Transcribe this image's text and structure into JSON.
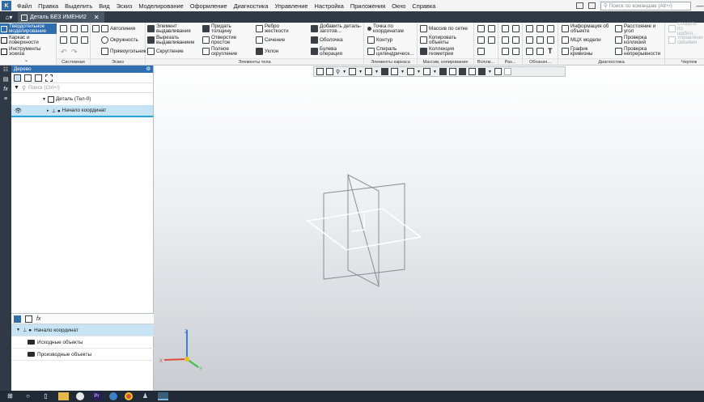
{
  "menu": {
    "logo_icon": "kompas-logo-icon",
    "items": [
      "Файл",
      "Правка",
      "Выделить",
      "Вид",
      "Эскиз",
      "Моделирование",
      "Оформление",
      "Диагностика",
      "Управление",
      "Настройка",
      "Приложения",
      "Окно",
      "Справка"
    ],
    "search_placeholder": "Поиск по командам (Alt+/)"
  },
  "tabs": {
    "home_icon": "home-icon",
    "active_title": "Деталь БЕЗ ИМЕНИ2",
    "close": "✕"
  },
  "modes": [
    {
      "label": "Твердотельное моделирование",
      "active": true
    },
    {
      "label": "Каркас и поверхности",
      "active": false
    },
    {
      "label": "Инструменты эскиза",
      "active": false
    }
  ],
  "ribbon": {
    "groups": {
      "system": "Системная",
      "sketch": "Эскиз",
      "body": "Элементы тела",
      "frame": "Элементы каркаса",
      "arrays": "Массив, копирование",
      "aux": "Вспом...",
      "sections": "Раз...",
      "notation": "Обознач...",
      "diagnostics": "Диагностика",
      "drawing": "Чертеж"
    },
    "sketch": {
      "line": "Автолиния",
      "circle": "Окружность",
      "rect": "Прямоугольник"
    },
    "body": {
      "extrude": "Элемент выдавливания",
      "cut": "Вырезать выдавливанием",
      "fillet": "Скругление",
      "thicken": "Придать толщину",
      "hole": "Отверстие простое",
      "full_round": "Полное скругление",
      "rib": "Ребро жесткости",
      "section": "Сечение",
      "draft": "Уклон",
      "blank": "Добавить деталь-заготов...",
      "shell": "Оболочка",
      "boolean": "Булева операция"
    },
    "frame": {
      "point": "Точка по координатам",
      "contour": "Контур",
      "spiral": "Спираль цилиндрическ..."
    },
    "arrays": {
      "grid": "Массив по сетке",
      "copy": "Копировать объекты",
      "collection": "Коллекция геометрии"
    },
    "diagnostics": {
      "info": "Информация об объекте",
      "mcc": "МЦХ модели",
      "curvature": "График кривизны",
      "distance": "Расстояние и угол",
      "collisions": "Проверка коллизий",
      "continuity": "Проверка непрерывности"
    },
    "drawing": {
      "create": "Создать по шабло...",
      "manage": "Управление связями"
    }
  },
  "tree": {
    "title": "Дерево",
    "search_placeholder": "Поиск (Ctrl+/)",
    "root": "Деталь (Тел-0)",
    "origin": "Начало координат",
    "bottom": {
      "origin": "Начало координат",
      "source": "Исходные объекты",
      "derived": "Производные объекты"
    }
  },
  "left_strip_icons": [
    "tree-icon",
    "properties-icon",
    "variables-icon",
    "menu-icon"
  ],
  "triad": {
    "x": "X",
    "y": "Y",
    "z": "Z"
  },
  "taskbar": {
    "icons": [
      "windows-start-icon",
      "search-icon",
      "task-view-icon",
      "file-explorer-icon",
      "yandex-icon",
      "premiere-icon",
      "chrome-alt-icon",
      "chrome-icon",
      "steam-icon",
      "kompas-icon"
    ],
    "premiere_label": "Pr"
  },
  "colors": {
    "accent": "#2f6fb0",
    "selection": "#c6e4f4",
    "dark": "#2f3a46"
  }
}
